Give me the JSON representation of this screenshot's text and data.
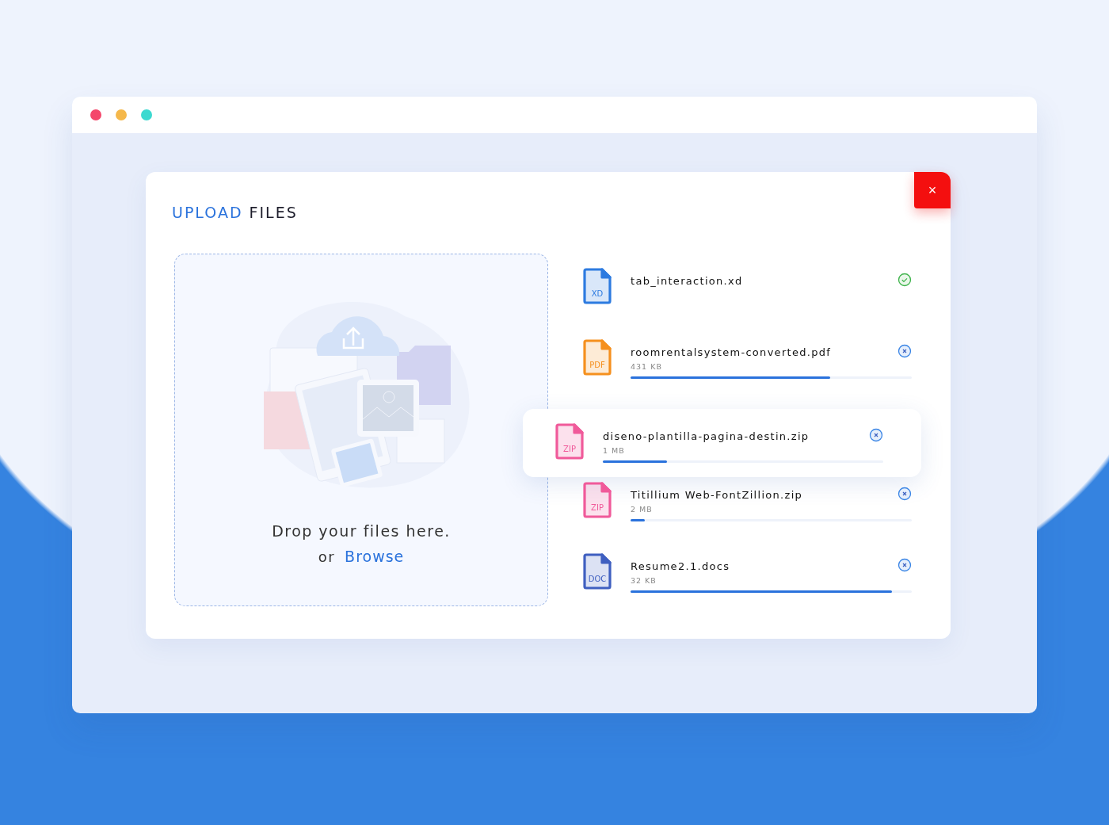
{
  "window": {
    "dots": [
      {
        "color": "#f4476b"
      },
      {
        "color": "#f5b84b"
      },
      {
        "color": "#3dd9d0"
      }
    ]
  },
  "dialog": {
    "title_accent": "UPLOAD",
    "title": "FILES",
    "close": "×",
    "dropzone": {
      "prompt": "Drop your files here.",
      "or": "or",
      "link": "Browse"
    },
    "files": [
      {
        "name": "tab_interaction.xd",
        "badge": "XD",
        "color": "#2d7be0",
        "complete": true,
        "raised": false
      },
      {
        "name": "roomrentalsystem-converted.pdf",
        "badge": "PDF",
        "color": "#f5901e",
        "size": "431 KB",
        "complete": false,
        "level": 0.71,
        "raised": false
      },
      {
        "name": "diseno-plantilla-pagina-destin.zip",
        "badge": "ZIP",
        "color": "#f05a9a",
        "size": "1 MB",
        "complete": false,
        "level": 0.23,
        "raised": true
      },
      {
        "name": "Titillium Web-FontZillion.zip",
        "badge": "ZIP",
        "color": "#f05a9a",
        "size": "2 MB",
        "complete": false,
        "level": 0.05,
        "raised": false
      },
      {
        "name": "Resume2.1.docs",
        "badge": "DOC",
        "color": "#3f5fc0",
        "size": "32 KB",
        "complete": false,
        "level": 0.93,
        "raised": false
      }
    ]
  }
}
